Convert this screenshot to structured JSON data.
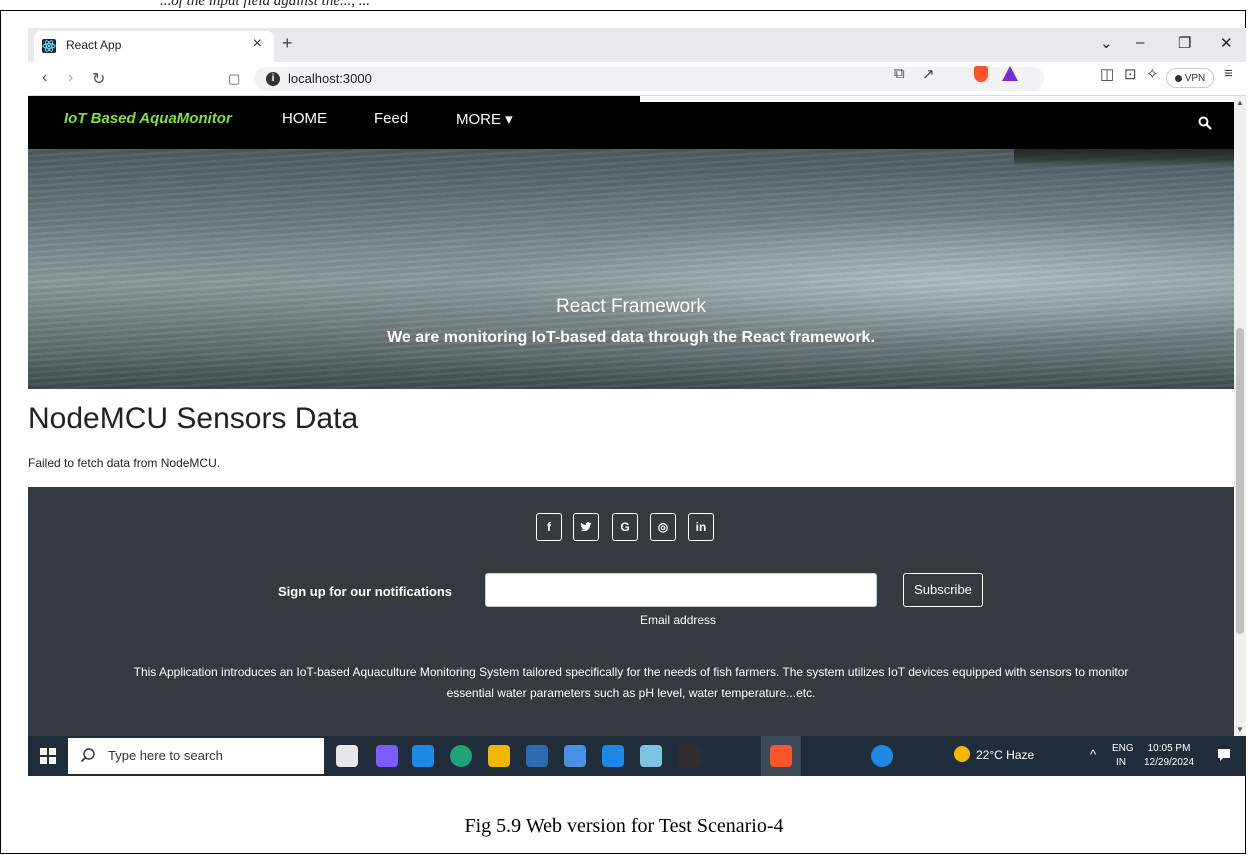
{
  "doc_header_fragment": "...of the input field against the..., ...",
  "browser": {
    "tab_title": "React App",
    "tab_close": "×",
    "new_tab": "+",
    "url": "localhost:3000",
    "vpn_label": "VPN",
    "window_controls": [
      "⌄",
      "–",
      "❐",
      "✕"
    ]
  },
  "navbar": {
    "brand": "IoT Based AquaMonitor",
    "links": [
      "HOME",
      "Feed",
      "MORE ▾"
    ]
  },
  "hero": {
    "title": "React Framework",
    "subtitle": "We are monitoring IoT-based data through the React framework."
  },
  "sensors": {
    "title": "NodeMCU Sensors Data",
    "status": "Failed to fetch data from NodeMCU."
  },
  "footer": {
    "social": [
      "f",
      "𝕪",
      "G",
      "◎",
      "in"
    ],
    "signup_label": "Sign up for our notifications",
    "email_caption": "Email address",
    "subscribe_label": "Subscribe",
    "description": "This Application introduces an IoT-based Aquaculture Monitoring System tailored specifically for the needs of fish farmers. The system utilizes IoT devices equipped with sensors to monitor essential water parameters such as pH level, water temperature...etc."
  },
  "taskbar": {
    "search_placeholder": "Type here to search",
    "weather": "22°C  Haze",
    "lang_line1": "ENG",
    "lang_line2": "IN",
    "time": "10:05 PM",
    "date": "12/29/2024",
    "app_colors": [
      "#e8e8e8",
      "#7a5cff",
      "#1e88e5",
      "#1fa37a",
      "#f2b705",
      "#2b6cb0",
      "#4a90e2",
      "#1e88e5",
      "#7dc4e4",
      "#2d2d2d",
      "#fb542b",
      "#1e88e5"
    ]
  },
  "caption": "Fig 5.9 Web version for Test Scenario-4"
}
